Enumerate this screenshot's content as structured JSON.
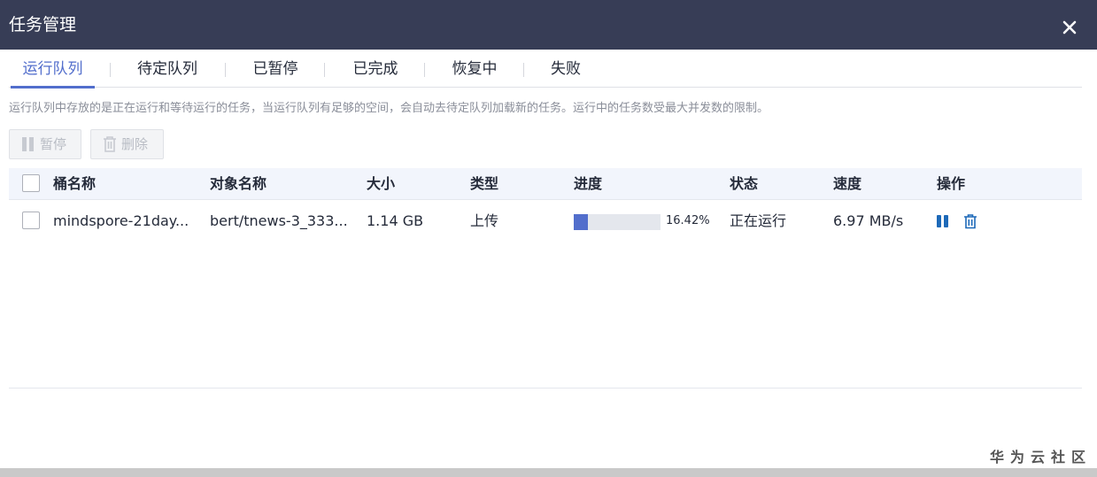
{
  "dialog": {
    "title": "任务管理"
  },
  "tabs": [
    {
      "label": "运行队列",
      "active": true
    },
    {
      "label": "待定队列",
      "active": false
    },
    {
      "label": "已暂停",
      "active": false
    },
    {
      "label": "已完成",
      "active": false
    },
    {
      "label": "恢复中",
      "active": false
    },
    {
      "label": "失败",
      "active": false
    }
  ],
  "description": "运行队列中存放的是正在运行和等待运行的任务，当运行队列有足够的空间，会自动去待定队列加载新的任务。运行中的任务数受最大并发数的限制。",
  "toolbar": {
    "pause_label": "暂停",
    "delete_label": "删除"
  },
  "table": {
    "headers": {
      "bucket": "桶名称",
      "object": "对象名称",
      "size": "大小",
      "type": "类型",
      "progress": "进度",
      "status": "状态",
      "speed": "速度",
      "actions": "操作"
    },
    "rows": [
      {
        "bucket": "mindspore-21day...",
        "object": "bert/tnews-3_333...",
        "size": "1.14 GB",
        "type": "上传",
        "progress_text": "16.42%",
        "progress_fraction": 0.1642,
        "status": "正在运行",
        "speed": "6.97 MB/s"
      }
    ]
  },
  "watermark": "华为云社区",
  "colors": {
    "header_bg": "#373d56",
    "accent": "#526ecc",
    "table_header_bg": "#f2f5fc"
  },
  "icons": {
    "close": "close-icon",
    "pause": "pause-icon",
    "delete": "trash-icon"
  }
}
